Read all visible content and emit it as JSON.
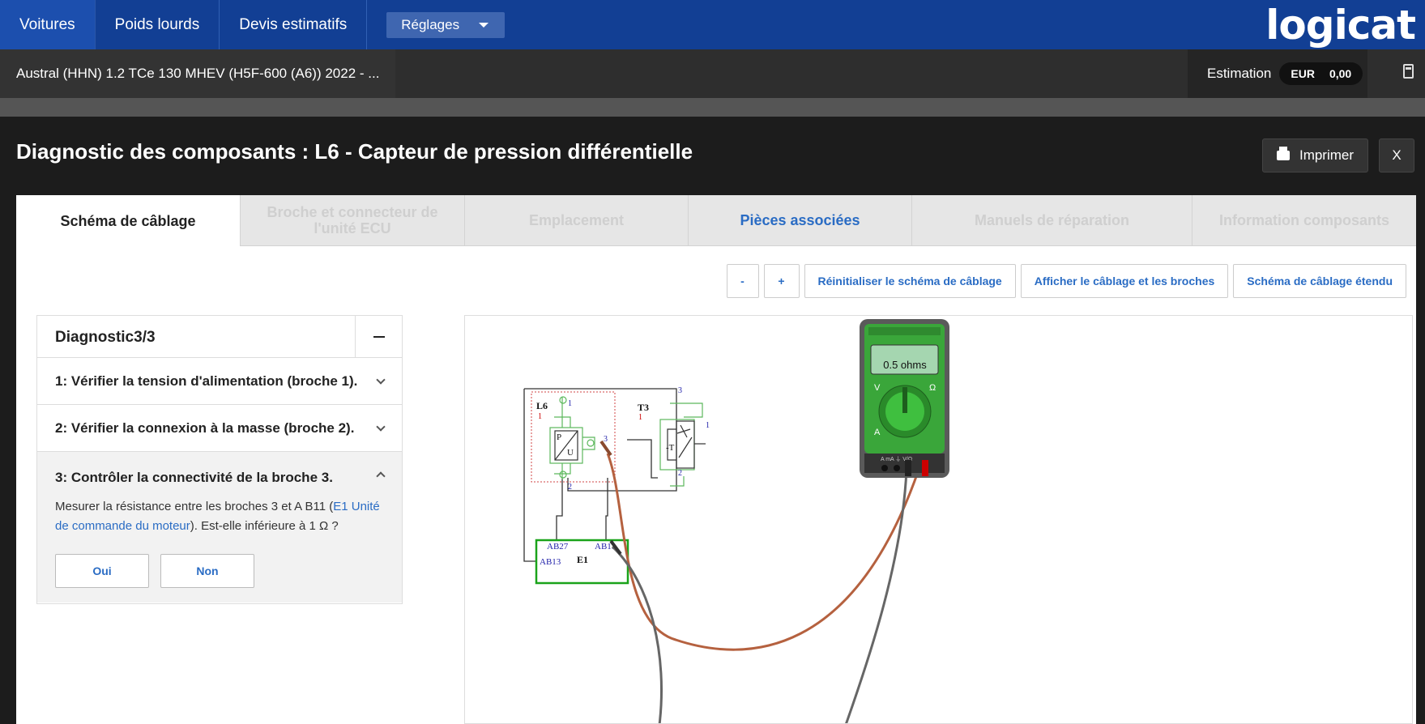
{
  "nav": {
    "items": [
      "Voitures",
      "Poids lourds",
      "Devis estimatifs"
    ],
    "settings_label": "Réglages",
    "logo": "logicat"
  },
  "vehicle": {
    "description": "Austral (HHN) 1.2 TCe 130 MHEV (H5F-600 (A6)) 2022 - ...",
    "estimation_label": "Estimation",
    "currency": "EUR",
    "amount": "0,00"
  },
  "dialog": {
    "title": "Diagnostic des composants : L6 - Capteur de pression différentielle",
    "print_label": "Imprimer",
    "close_label": "X"
  },
  "tabs": [
    {
      "label": "Schéma de câblage",
      "state": "active"
    },
    {
      "label": "Broche et connecteur de l'unité ECU",
      "state": "disabled"
    },
    {
      "label": "Emplacement",
      "state": "disabled"
    },
    {
      "label": "Pièces associées",
      "state": "link"
    },
    {
      "label": "Manuels de réparation",
      "state": "disabled"
    },
    {
      "label": "Information composants",
      "state": "disabled"
    }
  ],
  "toolbar": {
    "zoom_out": "-",
    "zoom_in": "+",
    "reset": "Réinitialiser le schéma de câblage",
    "show_wiring": "Afficher le câblage et les broches",
    "extended": "Schéma de câblage étendu"
  },
  "diagnostic": {
    "title": "Diagnostic3/3",
    "steps": [
      "1: Vérifier la tension d'alimentation (broche 1).",
      "2: Vérifier la connexion à la masse (broche 2).",
      "3: Contrôler la connectivité de la broche 3."
    ],
    "step3_text_before": "Mesurer la résistance entre les broches 3 et A B11 (",
    "step3_link": "E1 Unité de commande du moteur",
    "step3_text_after": "). Est-elle inférieure à 1 Ω ?",
    "yes_label": "Oui",
    "no_label": "Non"
  },
  "schema": {
    "sensor_label": "L6",
    "sensor_num": "1",
    "switch_label": "T3",
    "switch_num": "1",
    "ecu_label": "E1",
    "pin_ab27": "AB27",
    "pin_ab11": "AB11",
    "pin_ab13": "AB13",
    "pin1": "1",
    "pin2": "2",
    "pin3": "3",
    "sensor_p": "P",
    "sensor_u": "U",
    "switch_t": "-T",
    "meter_display": "0.5 ohms",
    "meter_v": "V",
    "meter_ohm": "Ω",
    "meter_a": "A",
    "meter_jacks": "A  mA  ⏚  V/Ω"
  },
  "colors": {
    "nav_bg": "#123f94",
    "accent_link": "#2a6cc4",
    "ecu_box": "#1aa31a",
    "probe_red": "#b5613f",
    "probe_black": "#666666"
  }
}
